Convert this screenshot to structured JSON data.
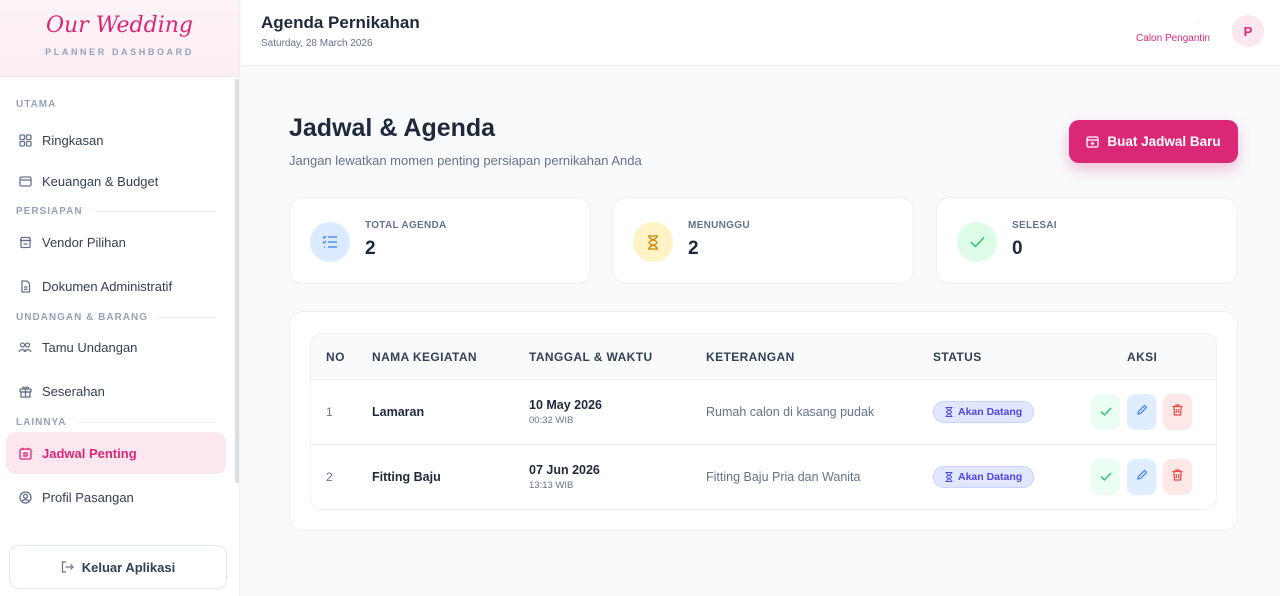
{
  "brand": {
    "logo": "Our Wedding",
    "subtitle": "PLANNER DASHBOARD"
  },
  "sidebar": {
    "sections": [
      {
        "label": "UTAMA"
      },
      {
        "label": "PERSIAPAN"
      },
      {
        "label": "UNDANGAN & BARANG"
      },
      {
        "label": "LAINNYA"
      }
    ],
    "items": [
      {
        "label": "Ringkasan",
        "icon": "grid-icon"
      },
      {
        "label": "Keuangan & Budget",
        "icon": "wallet-icon"
      },
      {
        "label": "Vendor Pilihan",
        "icon": "store-icon"
      },
      {
        "label": "Dokumen Administratif",
        "icon": "document-icon"
      },
      {
        "label": "Tamu Undangan",
        "icon": "users-icon"
      },
      {
        "label": "Seserahan",
        "icon": "gift-icon"
      },
      {
        "label": "Jadwal Penting",
        "icon": "calendar-icon",
        "active": true
      },
      {
        "label": "Profil Pasangan",
        "icon": "user-circle-icon"
      }
    ],
    "logout_label": "Keluar Aplikasi"
  },
  "header": {
    "title": "Agenda Pernikahan",
    "date": "Saturday, 28 March 2026",
    "dot": "-",
    "user_role": "Calon Pengantin",
    "avatar_initial": "P"
  },
  "main": {
    "title": "Jadwal & Agenda",
    "subtitle": "Jangan lewatkan momen penting persiapan pernikahan Anda",
    "new_button_label": "Buat Jadwal Baru",
    "stats": [
      {
        "label": "TOTAL AGENDA",
        "value": "2",
        "color": "#3b82f6"
      },
      {
        "label": "MENUNGGU",
        "value": "2",
        "color": "#eab308"
      },
      {
        "label": "SELESAI",
        "value": "0",
        "color": "#22c55e"
      }
    ],
    "table": {
      "columns": [
        "NO",
        "NAMA KEGIATAN",
        "TANGGAL & WAKTU",
        "KETERANGAN",
        "STATUS",
        "AKSI"
      ],
      "rows": [
        {
          "no": "1",
          "name": "Lamaran",
          "date": "10 May 2026",
          "time": "00:32 WIB",
          "description": "Rumah calon di kasang pudak",
          "status": "Akan Datang"
        },
        {
          "no": "2",
          "name": "Fitting Baju",
          "date": "07 Jun 2026",
          "time": "13:13 WIB",
          "description": "Fitting Baju Pria dan Wanita",
          "status": "Akan Datang"
        }
      ]
    }
  },
  "colors": {
    "accent": "#db2777",
    "status_badge": "#4f46e5"
  }
}
